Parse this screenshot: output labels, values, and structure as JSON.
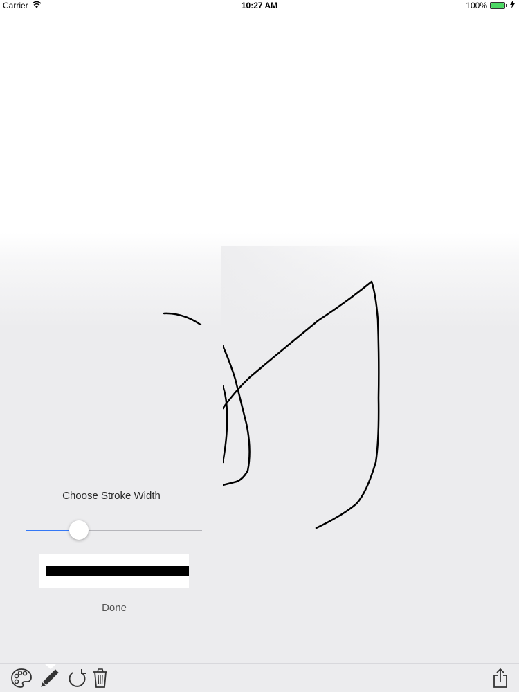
{
  "status_bar": {
    "carrier": "Carrier",
    "time": "10:27 AM",
    "battery_percent": "100%",
    "battery_level": 1.0,
    "battery_color": "#4cd964"
  },
  "stroke_popover": {
    "title": "Choose Stroke Width",
    "slider_value_fraction": 0.3,
    "slider_accent": "#3478f6",
    "done_label": "Done"
  },
  "toolbar": {
    "tools": [
      "palette-icon",
      "pencil-icon",
      "undo-icon",
      "trash-icon"
    ],
    "share": "share-icon"
  }
}
